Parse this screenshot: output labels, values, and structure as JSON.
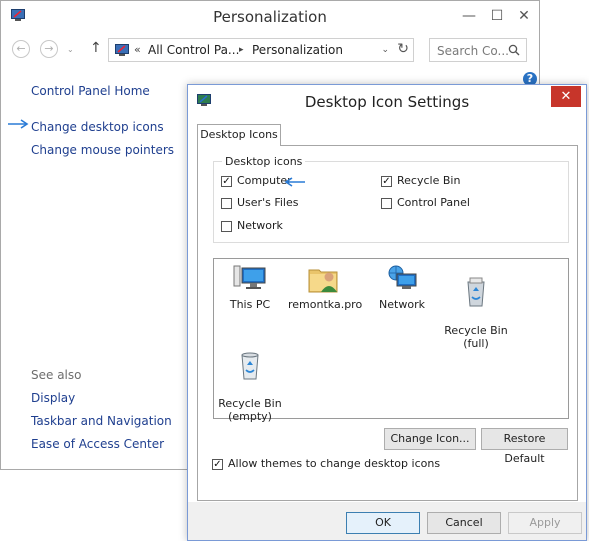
{
  "window": {
    "title": "Personalization",
    "minimize": "—",
    "maximize": "☐",
    "close": "✕"
  },
  "nav": {
    "back": "←",
    "forward": "→",
    "up": "↑",
    "dropdown": "⌄",
    "breadcrumb_prefix": "«",
    "breadcrumb": [
      "All Control Pa...",
      "Personalization"
    ],
    "refresh": "↻",
    "search_placeholder": "Search Co..."
  },
  "help": "?",
  "sidebar": {
    "home": "Control Panel Home",
    "links": [
      "Change desktop icons",
      "Change mouse pointers"
    ],
    "see_also": "See also",
    "see_also_links": [
      "Display",
      "Taskbar and Navigation",
      "Ease of Access Center"
    ]
  },
  "dialog": {
    "title": "Desktop Icon Settings",
    "close": "✕",
    "tab": "Desktop Icons",
    "group_label": "Desktop icons",
    "checkboxes": [
      {
        "label": "Computer",
        "checked": true
      },
      {
        "label": "Recycle Bin",
        "checked": true
      },
      {
        "label": "User's Files",
        "checked": false
      },
      {
        "label": "Control Panel",
        "checked": false
      },
      {
        "label": "Network",
        "checked": false
      }
    ],
    "icons": [
      {
        "label": "This PC"
      },
      {
        "label": "remontka.pro"
      },
      {
        "label": "Network"
      },
      {
        "label": "Recycle Bin\n(full)"
      },
      {
        "label": "Recycle Bin\n(empty)"
      }
    ],
    "change_icon": "Change Icon...",
    "restore_default": "Restore Default",
    "allow_themes": {
      "label": "Allow themes to change desktop icons",
      "checked": true
    },
    "ok": "OK",
    "cancel": "Cancel",
    "apply": "Apply"
  },
  "colors": {
    "link": "#1f3f8f",
    "accent_arrow": "#2a7bd6",
    "close_red": "#c7352a"
  }
}
